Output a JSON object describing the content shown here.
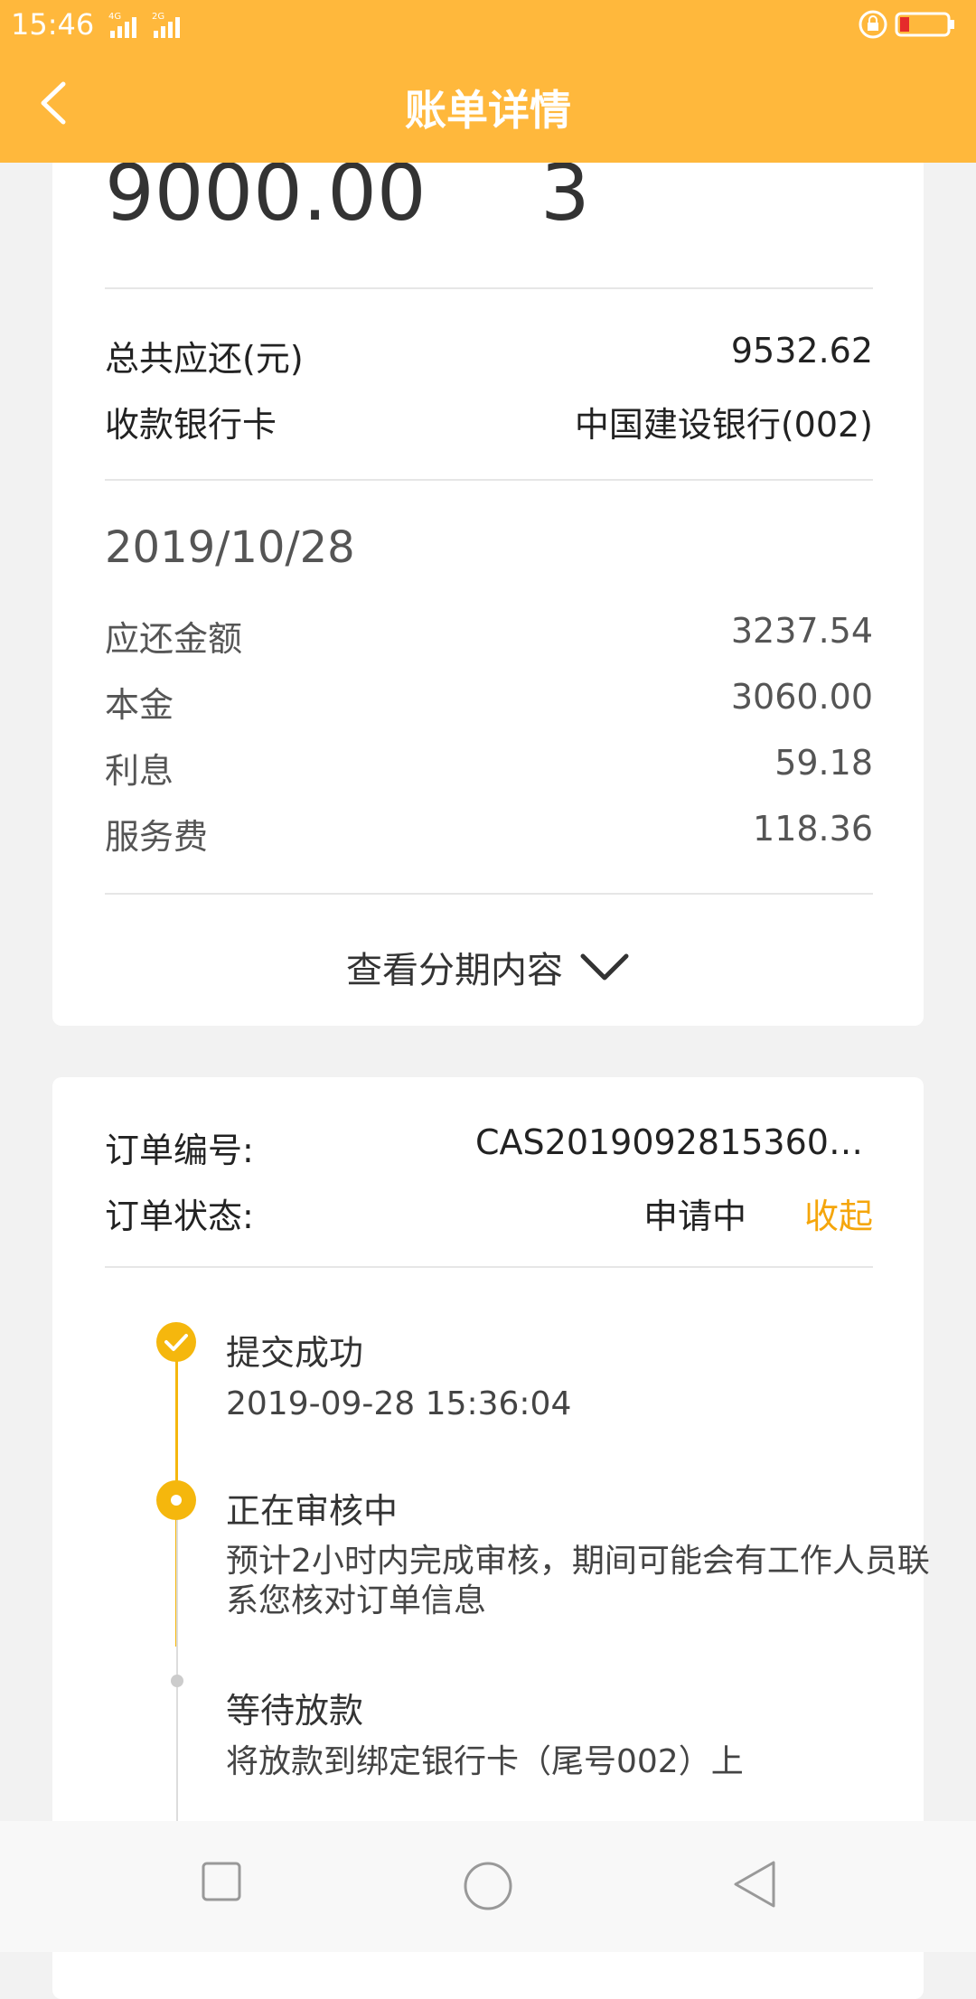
{
  "status_bar": {
    "time": "15:46",
    "network": "4G 2G"
  },
  "nav": {
    "title": "账单详情"
  },
  "loan": {
    "amount": "9000.00",
    "periods": "3"
  },
  "summary": [
    {
      "label": "总共应还(元)",
      "value": "9532.62"
    },
    {
      "label": "收款银行卡",
      "value": "中国建设银行(002)"
    }
  ],
  "due": {
    "date": "2019/10/28",
    "items": [
      {
        "label": "应还金额",
        "value": "3237.54"
      },
      {
        "label": "本金",
        "value": "3060.00"
      },
      {
        "label": "利息",
        "value": "59.18"
      },
      {
        "label": "服务费",
        "value": "118.36"
      }
    ]
  },
  "view_installments": {
    "label": "查看分期内容"
  },
  "order": {
    "id_label": "订单编号:",
    "id_value": "CAS20190928153603...",
    "status_label": "订单状态:",
    "status_value": "申请中",
    "collapse_label": "收起"
  },
  "timeline": [
    {
      "title": "提交成功",
      "desc": "2019-09-28 15:36:04",
      "state": "done"
    },
    {
      "title": "正在审核中",
      "desc": "预计2小时内完成审核，期间可能会有工作人员联系您核对订单信息",
      "state": "current"
    },
    {
      "title": "等待放款",
      "desc": "将放款到绑定银行卡（尾号002）上",
      "state": "pending"
    }
  ],
  "colors": {
    "brand": "#ffb83c",
    "accent": "#f5a60b"
  }
}
